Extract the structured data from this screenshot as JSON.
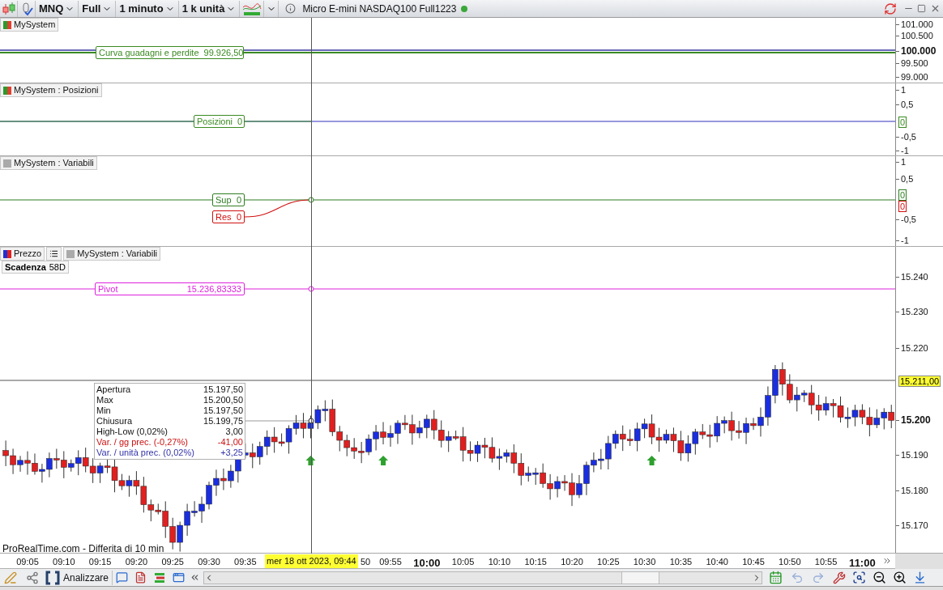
{
  "toolbar": {
    "symbol": "MNQ",
    "mode": "Full",
    "interval": "1 minuto",
    "units": "1 k unità",
    "instrument": "Micro E-mini NASDAQ100 Full1223"
  },
  "panels": [
    {
      "legend": [
        {
          "kind": "system",
          "label": "MySystem"
        }
      ],
      "lines": [
        {
          "label": "Curva guadagni e perdite",
          "value": "99.926,50",
          "color": "#3a8a22"
        }
      ],
      "axis": [
        {
          "text": "101.000",
          "kind": "tick"
        },
        {
          "text": "100.500",
          "kind": "tick"
        },
        {
          "text": "100.000",
          "kind": "bold"
        },
        {
          "text": "99.500",
          "kind": "tick"
        },
        {
          "text": "99.000",
          "kind": "tick"
        }
      ]
    },
    {
      "legend": [
        {
          "kind": "system",
          "label": "MySystem : Posizioni"
        }
      ],
      "lines": [
        {
          "label": "Posizioni",
          "value": "0",
          "color": "#3a8a22"
        }
      ],
      "axis": [
        {
          "text": "1",
          "kind": "tick"
        },
        {
          "text": "0,5",
          "kind": "tick"
        },
        {
          "text": "0",
          "kind": "marker",
          "color": "#3a8a22"
        },
        {
          "text": "-0,5",
          "kind": "tick"
        },
        {
          "text": "-1",
          "kind": "tick"
        }
      ]
    },
    {
      "legend": [
        {
          "kind": "variables",
          "label": "MySystem : Variabili"
        }
      ],
      "lines": [
        {
          "label": "Sup",
          "value": "0",
          "color": "#2e7d22"
        },
        {
          "label": "Res",
          "value": "0",
          "color": "#d01010"
        }
      ],
      "axis": [
        {
          "text": "1",
          "kind": "tick"
        },
        {
          "text": "0,5",
          "kind": "tick"
        },
        {
          "text": "0",
          "kind": "marker",
          "color": "#2e7d22"
        },
        {
          "text": "0",
          "kind": "marker",
          "color": "#d01010"
        },
        {
          "text": "-0,5",
          "kind": "tick"
        },
        {
          "text": "-1",
          "kind": "tick"
        }
      ]
    },
    {
      "legend": [
        {
          "kind": "price",
          "label": "Prezzo"
        },
        {
          "kind": "list"
        },
        {
          "kind": "variables",
          "label": "MySystem : Variabili"
        }
      ],
      "expiry": {
        "label": "Scadenza",
        "value": "58D"
      },
      "lines": [
        {
          "label": "Pivot",
          "value": "15.236,83333",
          "color": "#dd22dd"
        }
      ],
      "axis": [
        {
          "text": "15.240",
          "kind": "tick"
        },
        {
          "text": "15.230",
          "kind": "tick"
        },
        {
          "text": "15.220",
          "kind": "tick"
        },
        {
          "text": "15.211,00",
          "kind": "marker",
          "color": "#ffff33"
        },
        {
          "text": "15.200",
          "kind": "bold"
        },
        {
          "text": "15.190",
          "kind": "tick"
        },
        {
          "text": "15.180",
          "kind": "tick"
        },
        {
          "text": "15.170",
          "kind": "tick"
        }
      ],
      "tooltip": [
        {
          "label": "Apertura",
          "value": "15.197,50",
          "kind": "plain"
        },
        {
          "label": "Max",
          "value": "15.200,50",
          "kind": "plain"
        },
        {
          "label": "Min",
          "value": "15.197,50",
          "kind": "plain"
        },
        {
          "label": "Chiusura",
          "value": "15.199,75",
          "kind": "plain"
        },
        {
          "label": "High-Low (0,02%)",
          "value": "3,00",
          "kind": "plain"
        },
        {
          "label": "Var. / gg prec. (-0,27%)",
          "value": "-41,00",
          "kind": "daily"
        },
        {
          "label": "Var. / unità prec. (0,02%)",
          "value": "+3,25",
          "kind": "bar"
        }
      ],
      "source": "ProRealTime.com - Differita di 10 min"
    }
  ],
  "time_axis": {
    "labels": [
      {
        "text": "09:05",
        "bold": false
      },
      {
        "text": "09:10",
        "bold": false
      },
      {
        "text": "09:15",
        "bold": false
      },
      {
        "text": "09:20",
        "bold": false
      },
      {
        "text": "09:25",
        "bold": false
      },
      {
        "text": "09:30",
        "bold": false
      },
      {
        "text": "09:35",
        "bold": false
      },
      {
        "text": "50",
        "bold": false
      },
      {
        "text": "09:55",
        "bold": false
      },
      {
        "text": "10:00",
        "bold": true
      },
      {
        "text": "10:05",
        "bold": false
      },
      {
        "text": "10:10",
        "bold": false
      },
      {
        "text": "10:15",
        "bold": false
      },
      {
        "text": "10:20",
        "bold": false
      },
      {
        "text": "10:25",
        "bold": false
      },
      {
        "text": "10:30",
        "bold": false
      },
      {
        "text": "10:35",
        "bold": false
      },
      {
        "text": "10:40",
        "bold": false
      },
      {
        "text": "10:45",
        "bold": false
      },
      {
        "text": "10:50",
        "bold": false
      },
      {
        "text": "10:55",
        "bold": false
      },
      {
        "text": "11:00",
        "bold": true
      }
    ],
    "cursor": "mer 18 ott 2023, 09:44"
  },
  "bottom_toolbar": {
    "analyze": "Analizzare"
  }
}
